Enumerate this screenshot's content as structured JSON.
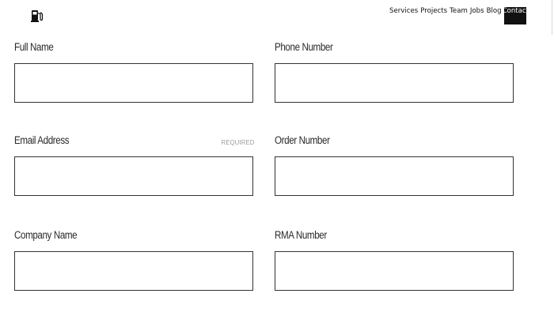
{
  "header": {
    "logo_icon": "fuel-pump-icon",
    "nav": [
      "Services",
      "Projects",
      "Team",
      "Jobs",
      "Blog"
    ],
    "contact_label": "Contact"
  },
  "form": {
    "full_name": {
      "label": "Full Name",
      "value": ""
    },
    "phone_number": {
      "label": "Phone Number",
      "value": ""
    },
    "email_address": {
      "label": "Email Address",
      "required": "REQUIRED",
      "value": ""
    },
    "order_number": {
      "label": "Order Number",
      "value": ""
    },
    "company_name": {
      "label": "Company Name",
      "value": ""
    },
    "rma_number": {
      "label": "RMA Number",
      "value": ""
    }
  }
}
